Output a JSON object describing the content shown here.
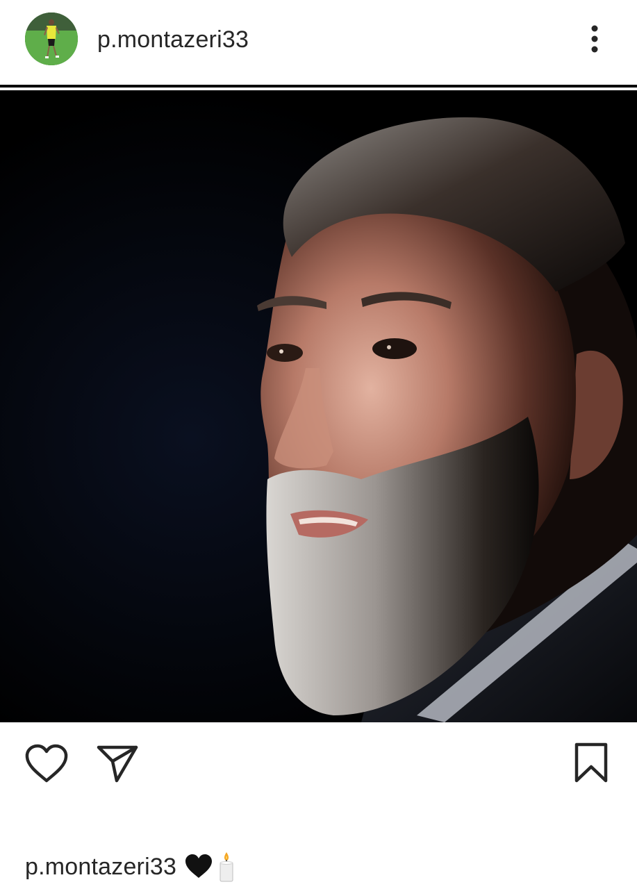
{
  "post": {
    "username": "p.montazeri33",
    "avatar_icon": "avatar-photo-icon",
    "more_icon": "more-vertical-icon",
    "image_alt": "portrait-photo",
    "actions": {
      "like_icon": "heart-outline-icon",
      "share_icon": "paper-plane-icon",
      "save_icon": "bookmark-outline-icon"
    },
    "caption": {
      "username": "p.montazeri33",
      "emojis": [
        "black-heart-icon",
        "candle-icon"
      ]
    }
  },
  "colors": {
    "text": "#262626",
    "divider": "#000000",
    "background": "#ffffff",
    "heart_emoji": "#111111"
  }
}
